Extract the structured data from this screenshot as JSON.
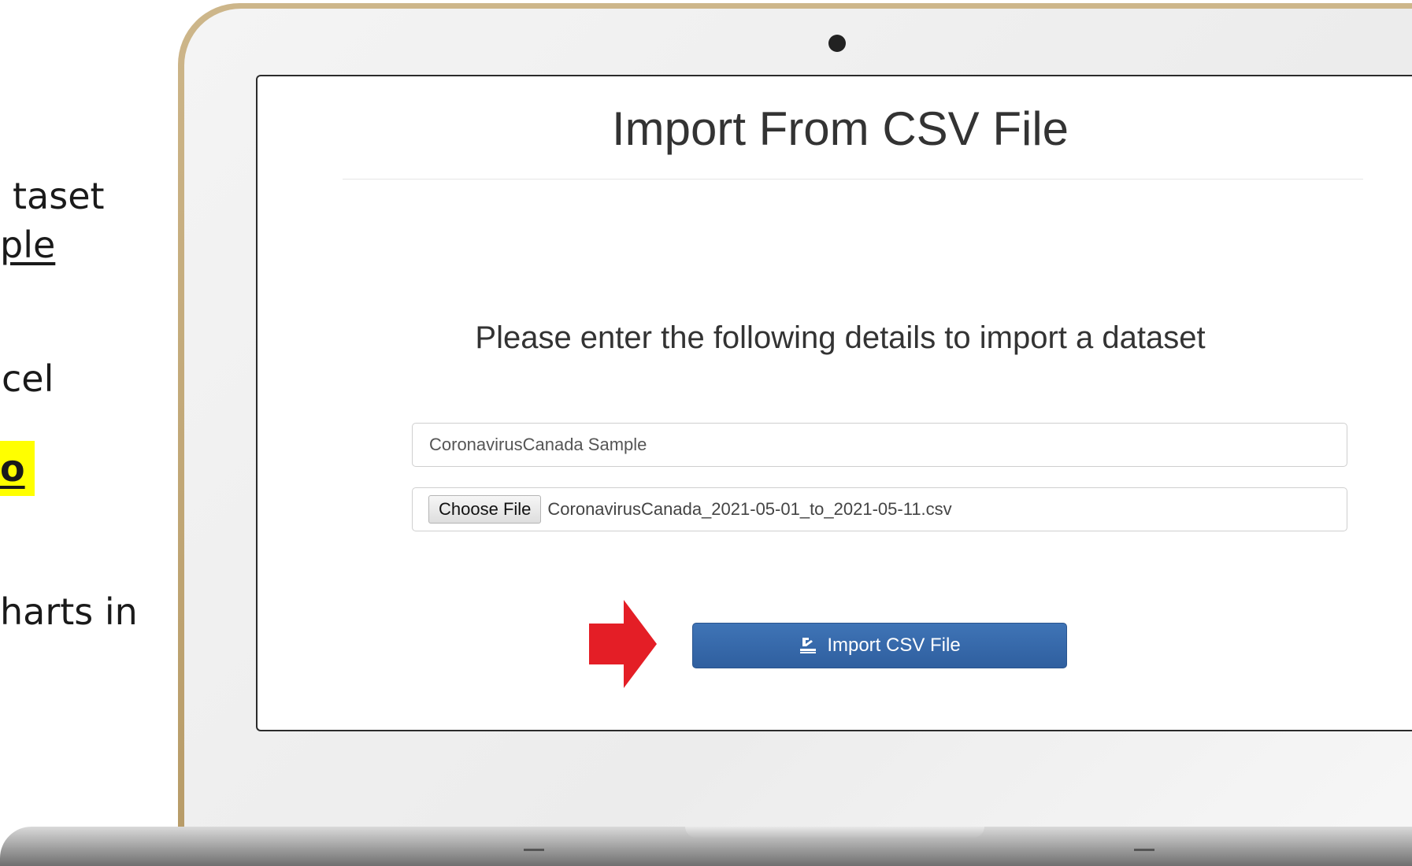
{
  "slide": {
    "fragments": [
      "taset",
      "ple",
      "cel",
      "o",
      "harts in"
    ]
  },
  "app": {
    "title": "Import From CSV File",
    "subtitle": "Please enter the following details to import a dataset",
    "dataset_name": {
      "value": "CoronavirusCanada Sample"
    },
    "file_input": {
      "button_label": "Choose File",
      "file_name": "CoronavirusCanada_2021-05-01_to_2021-05-11.csv"
    },
    "import_button": {
      "label": "Import CSV File",
      "icon": "import-icon",
      "color": "#3a6eb0"
    },
    "pointer": {
      "icon": "arrow-right-icon",
      "color": "#e41e26"
    }
  }
}
